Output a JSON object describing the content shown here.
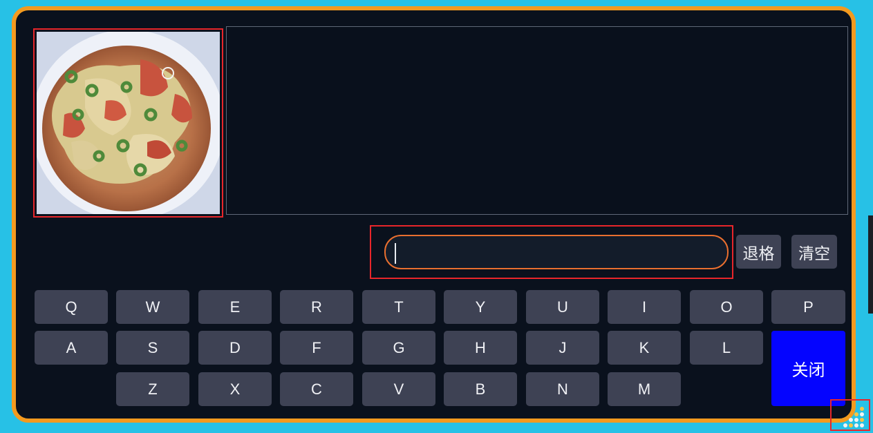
{
  "keyboard": {
    "row1": [
      "Q",
      "W",
      "E",
      "R",
      "T",
      "Y",
      "U",
      "I",
      "O",
      "P"
    ],
    "row2": [
      "A",
      "S",
      "D",
      "F",
      "G",
      "H",
      "J",
      "K",
      "L"
    ],
    "row3": [
      "Z",
      "X",
      "C",
      "V",
      "B",
      "N",
      "M"
    ],
    "backspace_label": "退格",
    "clear_label": "清空",
    "close_label": "关闭"
  },
  "input": {
    "value": "",
    "placeholder": ""
  },
  "icons": {
    "corner": "grip-dots-icon"
  },
  "colors": {
    "panel_border": "#f39a1f",
    "background": "#27c1e6",
    "close_button": "#0404ff",
    "highlight": "#e8262a"
  }
}
